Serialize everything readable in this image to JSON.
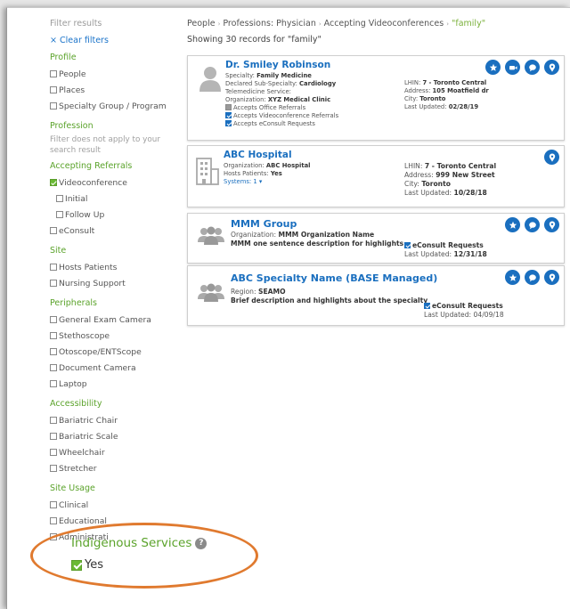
{
  "sidebar": {
    "title": "Filter results",
    "clear_filters": "Clear filters",
    "clear_icon": "×",
    "profile": {
      "label": "Profile",
      "items": [
        "People",
        "Places",
        "Specialty Group / Program"
      ]
    },
    "profession": {
      "label": "Profession",
      "note": "Filter does not apply to your search result"
    },
    "accepting": {
      "label": "Accepting Referrals",
      "videoconference": "Videoconference",
      "initial": "Initial",
      "follow_up": "Follow Up",
      "econsult": "eConsult"
    },
    "site": {
      "label": "Site",
      "items": [
        "Hosts Patients",
        "Nursing Support"
      ]
    },
    "peripherals": {
      "label": "Peripherals",
      "items": [
        "General Exam Camera",
        "Stethoscope",
        "Otoscope/ENTScope",
        "Document Camera",
        "Laptop"
      ]
    },
    "accessibility": {
      "label": "Accessibility",
      "items": [
        "Bariatric Chair",
        "Bariatric Scale",
        "Wheelchair",
        "Stretcher"
      ]
    },
    "site_usage": {
      "label": "Site Usage",
      "items": [
        "Clinical",
        "Educational",
        "Administrati"
      ]
    }
  },
  "breadcrumb": {
    "people": "People",
    "profession": "Professions: Physician",
    "accepting": "Accepting Videoconferences",
    "query": "\"family\"",
    "sep": "›"
  },
  "showing": "Showing 30 records for \"family\"",
  "cards": {
    "robinson": {
      "name": "Dr. Smiley Robinson",
      "specialty_label": "Specialty:",
      "specialty": "Family Medicine",
      "subspecialty_label": "Declared Sub-Specialty:",
      "subspecialty": "Cardiology",
      "telemedicine": "Telemedicine Service:",
      "org_label": "Organization:",
      "org": "XYZ Medical Clinic",
      "office": "Accepts Office Referrals",
      "video": "Accepts Videoconference Referrals",
      "econsult": "Accepts eConsult Requests",
      "lhin_label": "LHIN:",
      "lhin": "7 - Toronto Central",
      "address_label": "Address:",
      "address": "105 Moatfield dr",
      "city_label": "City:",
      "city": "Toronto",
      "updated_label": "Last Updated:",
      "updated": "02/28/19"
    },
    "abc_hospital": {
      "name": "ABC Hospital",
      "org_label": "Organization:",
      "org": "ABC Hospital",
      "hosts_label": "Hosts Patients:",
      "hosts": "Yes",
      "systems": "Systems: 1 ▾",
      "lhin_label": "LHIN:",
      "lhin": "7 - Toronto Central",
      "address_label": "Address:",
      "address": "999 New Street",
      "city_label": "City:",
      "city": "Toronto",
      "updated_label": "Last Updated:",
      "updated": "10/28/18"
    },
    "mmm": {
      "name": "MMM Group",
      "org_label": "Organization:",
      "org": "MMM Organization Name",
      "desc": "MMM one sentence description for highlights",
      "econsult": "eConsult Requests",
      "updated_label": "Last Updated:",
      "updated": "12/31/18"
    },
    "abc_specialty": {
      "name": "ABC Specialty Name (BASE Managed)",
      "region_label": "Region:",
      "region": "SEAMO",
      "desc": "Brief description and highlights about the specialty",
      "econsult": "eConsult Requests",
      "updated_label": "Last Updated:",
      "updated": "04/09/18"
    }
  },
  "callout": {
    "title": "Indigenous Services",
    "help": "?",
    "yes": "Yes"
  },
  "colors": {
    "accent_blue": "#1a6fbf",
    "accent_green": "#5ba32b",
    "callout_orange": "#e07a2f"
  },
  "icons": [
    "star-icon",
    "video-icon",
    "chat-icon",
    "location-pin-icon",
    "person-icon",
    "building-icon",
    "group-icon",
    "help-icon"
  ]
}
